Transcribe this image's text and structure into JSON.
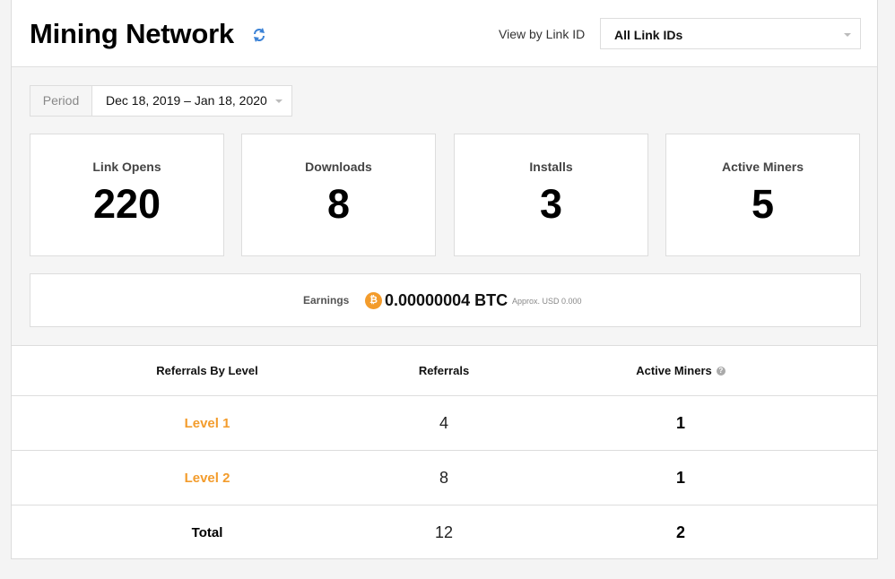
{
  "header": {
    "title": "Mining Network",
    "refresh_icon": "refresh-icon",
    "view_label": "View by Link ID",
    "link_select": {
      "value": "All Link IDs"
    }
  },
  "period": {
    "label": "Period",
    "value": "Dec 18, 2019 – Jan 18, 2020"
  },
  "stats": [
    {
      "label": "Link Opens",
      "value": "220"
    },
    {
      "label": "Downloads",
      "value": "8"
    },
    {
      "label": "Installs",
      "value": "3"
    },
    {
      "label": "Active Miners",
      "value": "5"
    }
  ],
  "earnings": {
    "label": "Earnings",
    "icon": "bitcoin-icon",
    "icon_glyph": "₿",
    "value": "0.00000004 BTC",
    "approx": "Approx. USD 0.000"
  },
  "table": {
    "headers": [
      "Referrals By Level",
      "Referrals",
      "Active Miners"
    ],
    "help_glyph": "?",
    "rows": [
      {
        "level": "Level 1",
        "referrals": "4",
        "active_miners": "1"
      },
      {
        "level": "Level 2",
        "referrals": "8",
        "active_miners": "1"
      }
    ],
    "total": {
      "label": "Total",
      "referrals": "12",
      "active_miners": "2"
    }
  },
  "colors": {
    "accent_orange": "#f39c2c",
    "refresh_blue": "#3b82d6"
  }
}
